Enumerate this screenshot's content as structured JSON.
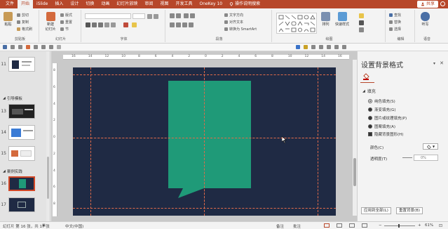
{
  "tabs": [
    "文件",
    "开始",
    "iSlide",
    "插入",
    "设计",
    "切换",
    "动画",
    "幻灯片放映",
    "审阅",
    "视图",
    "开发工具",
    "OneKey 10",
    "操作说明搜索"
  ],
  "active_tab": "开始",
  "share_label": "共享",
  "ribbon": {
    "clipboard": {
      "label": "剪贴板",
      "paste": "粘贴",
      "cut": "剪切",
      "copy": "复制",
      "format_painter": "格式刷"
    },
    "slides": {
      "label": "幻灯片",
      "new_slide": "新建\n幻灯片",
      "layout": "版式",
      "reset": "重置",
      "section": "节"
    },
    "font": {
      "label": "字体"
    },
    "paragraph": {
      "label": "段落",
      "text_direction": "文字方向",
      "align_text": "对齐文本",
      "smartart": "转换为 SmartArt"
    },
    "drawing": {
      "label": "绘图",
      "arrange": "排列",
      "quick_styles": "快速样式"
    },
    "editing": {
      "label": "编辑",
      "find": "查找",
      "replace": "替换",
      "select": "选择"
    },
    "voice": {
      "label": "语音",
      "dictate": "听写"
    }
  },
  "slide_panel": {
    "items": [
      {
        "num": "11",
        "section": null
      },
      {
        "num": "13",
        "section": "引导模板"
      },
      {
        "num": "14",
        "section": null
      },
      {
        "num": "15",
        "section": null
      },
      {
        "num": "16",
        "section": "案例实践"
      },
      {
        "num": "17",
        "section": null
      }
    ],
    "selected": "16"
  },
  "ruler": {
    "h": [
      "16",
      "14",
      "12",
      "10",
      "8",
      "6",
      "4",
      "2",
      "0",
      "2",
      "4",
      "6",
      "8",
      "10",
      "12",
      "14",
      "16"
    ],
    "v": [
      "8",
      "6",
      "4",
      "2",
      "0",
      "2",
      "4",
      "6",
      "8"
    ]
  },
  "format_pane": {
    "title": "设置背景格式",
    "fill_header": "填充",
    "options": [
      "纯色填充(S)",
      "渐变填充(G)",
      "图片或纹理填充(P)",
      "图案填充(A)"
    ],
    "selected_option": "纯色填充(S)",
    "hide_bg": "隐藏背景图形(H)",
    "color_label": "颜色(C)",
    "transparency_label": "透明度(T)",
    "transparency_value": "0%",
    "apply_all": "应用到全部(L)",
    "reset_bg": "重置背景(B)"
  },
  "status": {
    "slide_info": "幻灯片 第 16 张，共 17 张",
    "language": "中文(中国)",
    "notes": "备注",
    "comments": "批注",
    "zoom": "61%"
  },
  "colors": {
    "accent": "#b7472a",
    "slide_bg": "#1f2a44",
    "shape": "#1f9a78",
    "guide": "#e16b4a"
  }
}
